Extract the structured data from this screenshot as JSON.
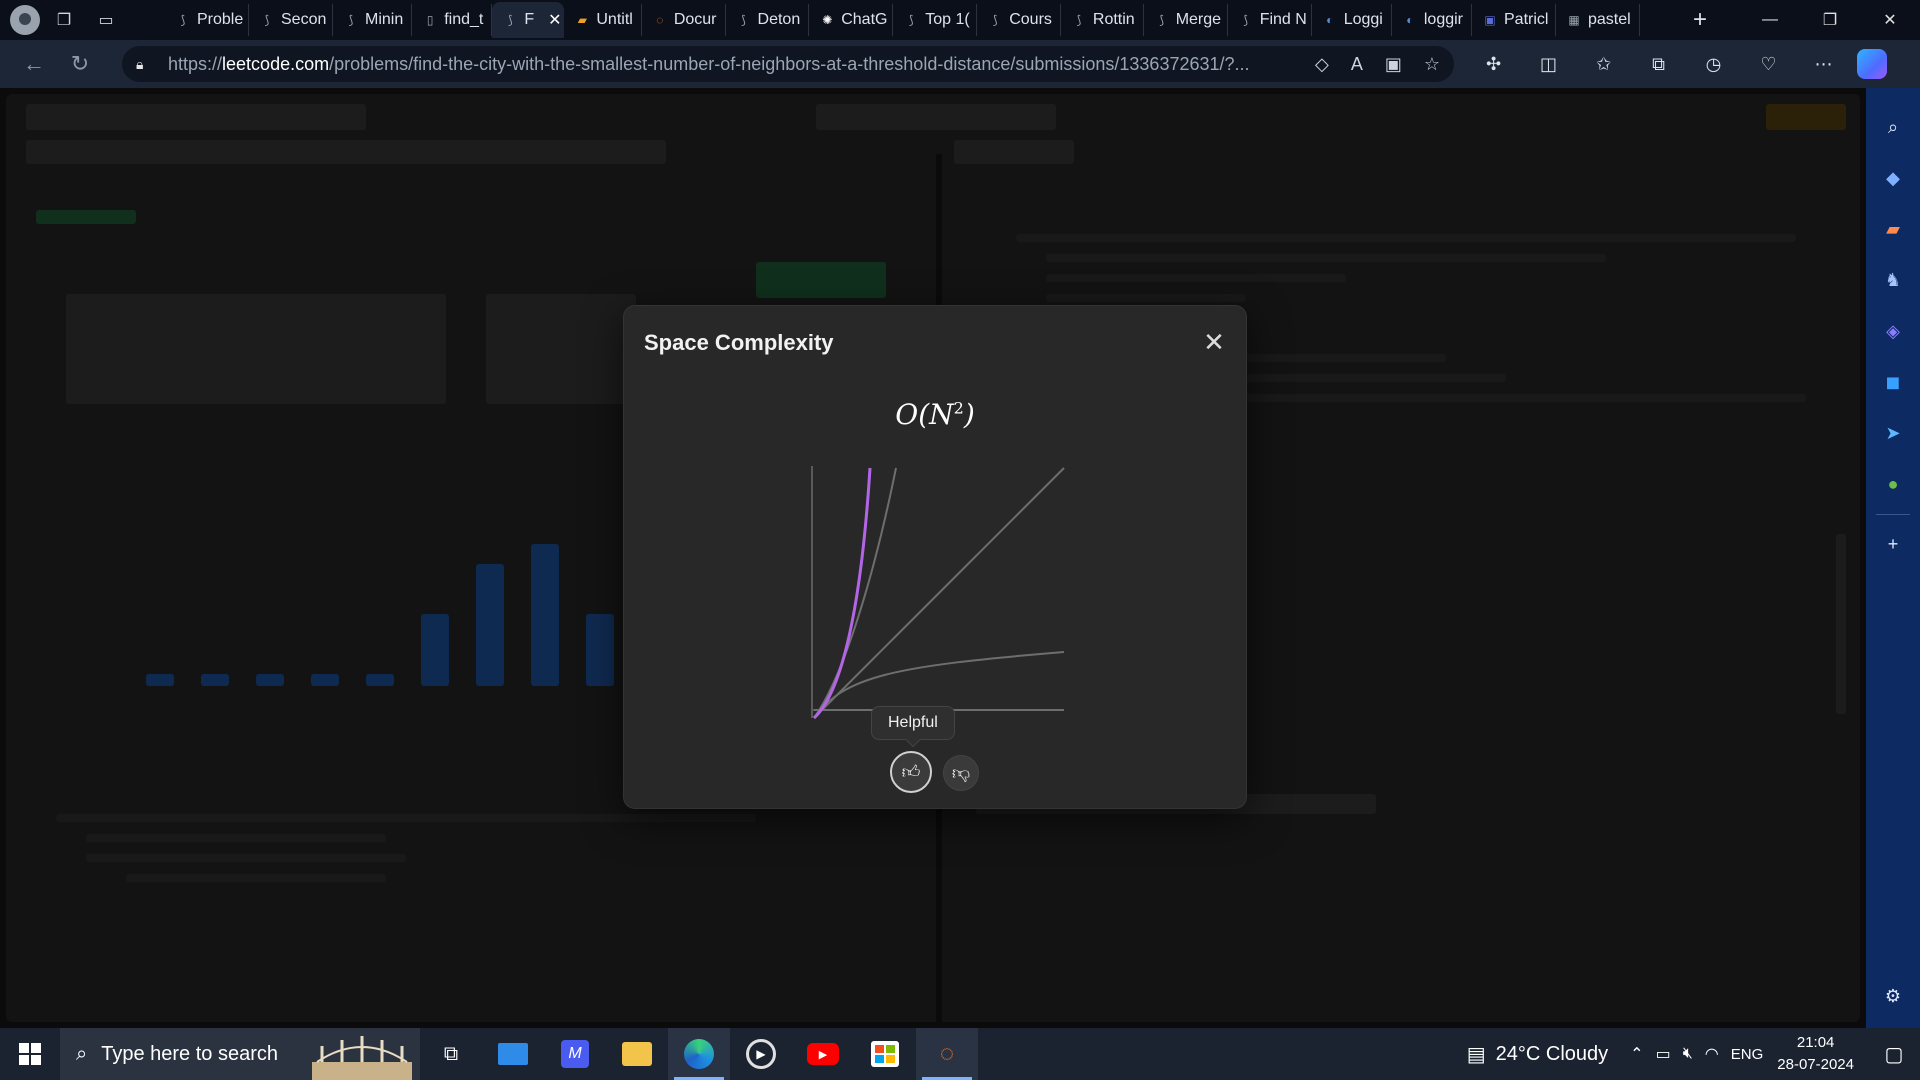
{
  "browser": {
    "tabs": [
      {
        "label": "Proble",
        "icon": "leetcode-icon"
      },
      {
        "label": "Secon",
        "icon": "leetcode-icon"
      },
      {
        "label": "Minin",
        "icon": "leetcode-icon"
      },
      {
        "label": "find_t",
        "icon": "document-icon"
      },
      {
        "label": "F",
        "icon": "leetcode-icon",
        "active": true
      },
      {
        "label": "Untitl",
        "icon": "notebook-icon"
      },
      {
        "label": "Docur",
        "icon": "jupyter-icon"
      },
      {
        "label": "Deton",
        "icon": "leetcode-icon"
      },
      {
        "label": "ChatG",
        "icon": "chatgpt-icon"
      },
      {
        "label": "Top 1(",
        "icon": "leetcode-icon"
      },
      {
        "label": "Cours",
        "icon": "leetcode-icon"
      },
      {
        "label": "Rottin",
        "icon": "leetcode-icon"
      },
      {
        "label": "Merge",
        "icon": "leetcode-icon"
      },
      {
        "label": "Find N",
        "icon": "leetcode-icon"
      },
      {
        "label": "Loggi",
        "icon": "python-icon"
      },
      {
        "label": "loggir",
        "icon": "python-icon"
      },
      {
        "label": "Patricl",
        "icon": "profile-icon"
      },
      {
        "label": "pastel",
        "icon": "grid-icon"
      }
    ],
    "url_host": "leetcode.com",
    "url_prefix": "https://",
    "url_path": "/problems/find-the-city-with-the-smallest-number-of-neighbors-at-a-threshold-distance/submissions/1336372631/?..."
  },
  "modal": {
    "title": "Space Complexity",
    "formula_base": "O(N",
    "formula_exp": "2",
    "formula_close": ")",
    "tooltip": "Helpful",
    "colors": {
      "highlight_curve": "#b266e6",
      "other_curves": "#6e6e6e"
    }
  },
  "taskbar": {
    "search_placeholder": "Type here to search",
    "weather": "24°C  Cloudy",
    "language": "ENG",
    "time": "21:04",
    "date": "28-07-2024"
  }
}
